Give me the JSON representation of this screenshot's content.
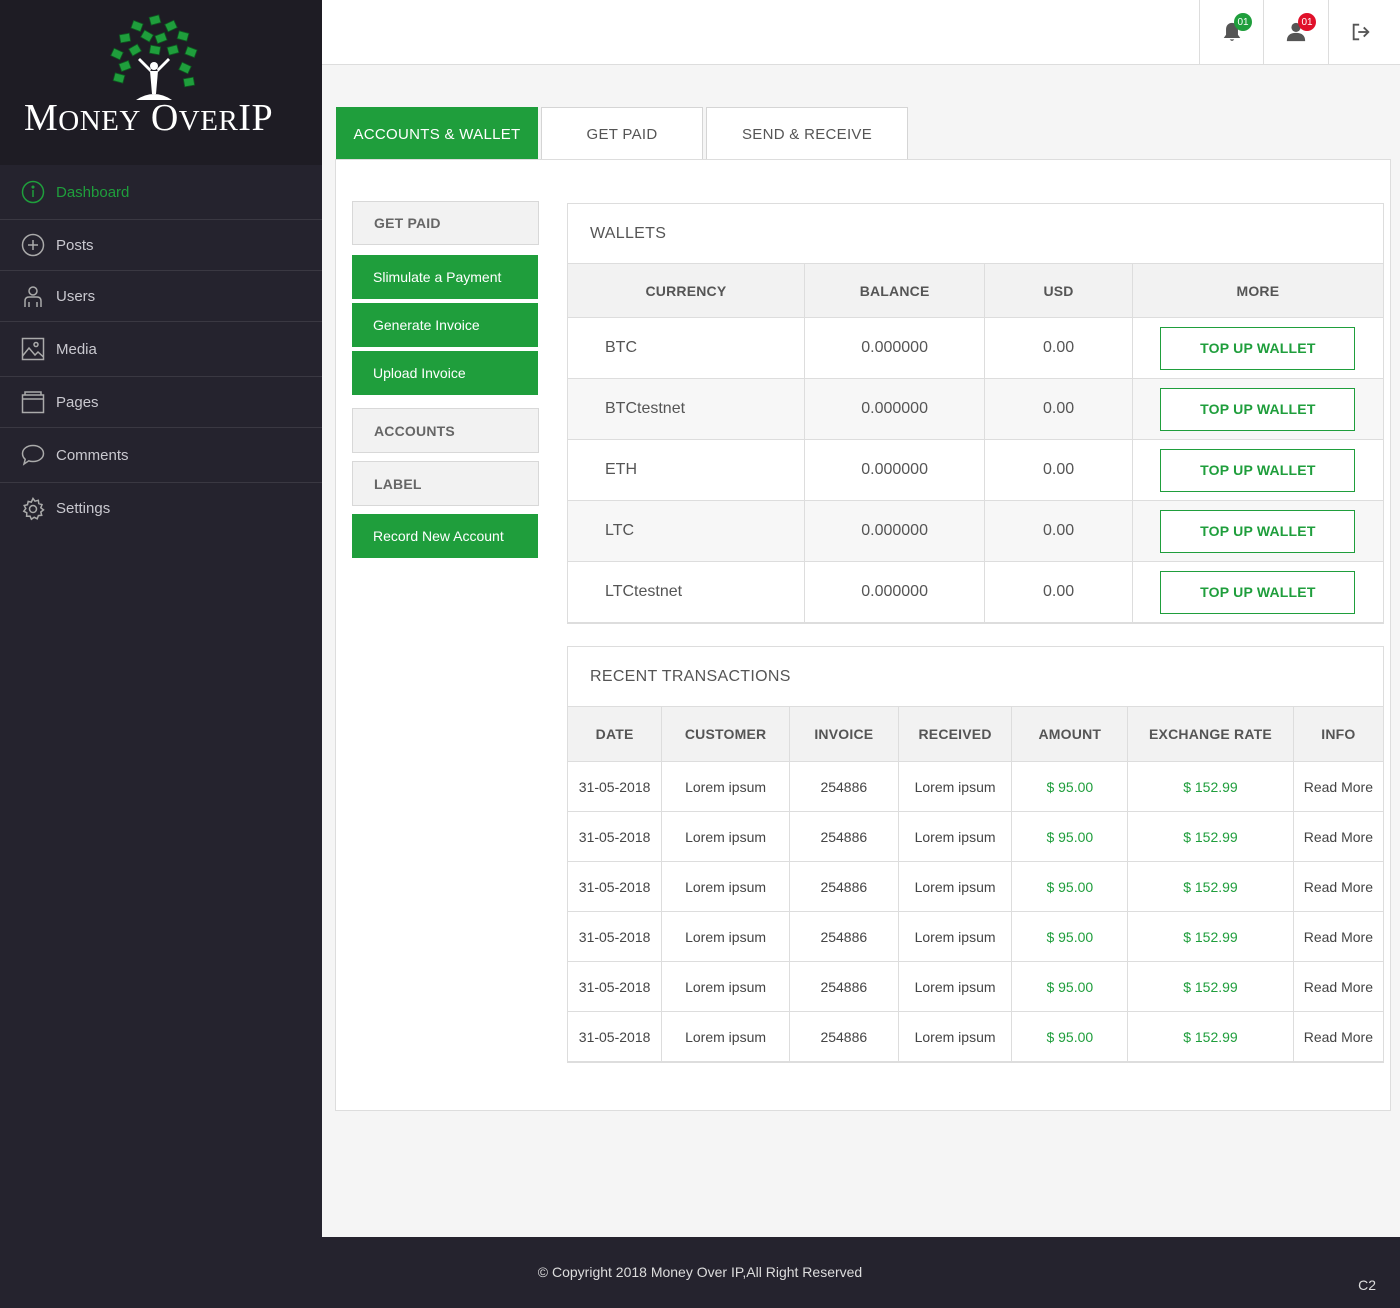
{
  "brand": {
    "part1_big": "M",
    "part1_small": "ONEY",
    "part2_big": "O",
    "part2_small": "VER",
    "part3": "IP"
  },
  "sidebar": {
    "items": [
      {
        "label": "Dashboard",
        "icon": "info-circle-icon"
      },
      {
        "label": "Posts",
        "icon": "plus-circle-icon"
      },
      {
        "label": "Users",
        "icon": "user-icon"
      },
      {
        "label": "Media",
        "icon": "image-icon"
      },
      {
        "label": "Pages",
        "icon": "pages-icon"
      },
      {
        "label": "Comments",
        "icon": "comment-icon"
      },
      {
        "label": "Settings",
        "icon": "gear-icon"
      }
    ]
  },
  "topbar": {
    "notifications_badge": "01",
    "profile_badge": "01"
  },
  "tabs": [
    {
      "label": "ACCOUNTS & WALLET"
    },
    {
      "label": "GET PAID"
    },
    {
      "label": "SEND & RECEIVE"
    }
  ],
  "side_actions": {
    "get_paid": "GET PAID",
    "simulate": "Slimulate a Payment",
    "generate": "Generate Invoice",
    "upload": "Upload Invoice",
    "accounts": "ACCOUNTS",
    "label": "LABEL",
    "record": "Record New Account"
  },
  "wallets": {
    "title": "WALLETS",
    "headers": [
      "CURRENCY",
      "BALANCE",
      "USD",
      "MORE"
    ],
    "button_label": "TOP UP WALLET",
    "rows": [
      {
        "currency": "BTC",
        "balance": "0.000000",
        "usd": "0.00"
      },
      {
        "currency": "BTCtestnet",
        "balance": "0.000000",
        "usd": "0.00"
      },
      {
        "currency": "ETH",
        "balance": "0.000000",
        "usd": "0.00"
      },
      {
        "currency": "LTC",
        "balance": "0.000000",
        "usd": "0.00"
      },
      {
        "currency": "LTCtestnet",
        "balance": "0.000000",
        "usd": "0.00"
      }
    ]
  },
  "transactions": {
    "title": "RECENT TRANSACTIONS",
    "headers": [
      "DATE",
      "CUSTOMER",
      "INVOICE",
      "RECEIVED",
      "AMOUNT",
      "EXCHANGE RATE",
      "INFO"
    ],
    "rows": [
      {
        "date": "31-05-2018",
        "customer": "Lorem ipsum",
        "invoice": "254886",
        "received": "Lorem ipsum",
        "amount": "$ 95.00",
        "rate": "$ 152.99",
        "info": "Read More"
      },
      {
        "date": "31-05-2018",
        "customer": "Lorem ipsum",
        "invoice": "254886",
        "received": "Lorem ipsum",
        "amount": "$ 95.00",
        "rate": "$ 152.99",
        "info": "Read More"
      },
      {
        "date": "31-05-2018",
        "customer": "Lorem ipsum",
        "invoice": "254886",
        "received": "Lorem ipsum",
        "amount": "$ 95.00",
        "rate": "$ 152.99",
        "info": "Read More"
      },
      {
        "date": "31-05-2018",
        "customer": "Lorem ipsum",
        "invoice": "254886",
        "received": "Lorem ipsum",
        "amount": "$ 95.00",
        "rate": "$ 152.99",
        "info": "Read More"
      },
      {
        "date": "31-05-2018",
        "customer": "Lorem ipsum",
        "invoice": "254886",
        "received": "Lorem ipsum",
        "amount": "$ 95.00",
        "rate": "$ 152.99",
        "info": "Read More"
      },
      {
        "date": "31-05-2018",
        "customer": "Lorem ipsum",
        "invoice": "254886",
        "received": "Lorem ipsum",
        "amount": "$ 95.00",
        "rate": "$ 152.99",
        "info": "Read More"
      }
    ]
  },
  "footer": {
    "copyright": "© Copyright  2018 Money Over IP,All Right Reserved",
    "corner": "C2"
  },
  "colors": {
    "accent": "#1f9e3c",
    "sidebar": "#25232e",
    "badge_red": "#e0102a"
  }
}
